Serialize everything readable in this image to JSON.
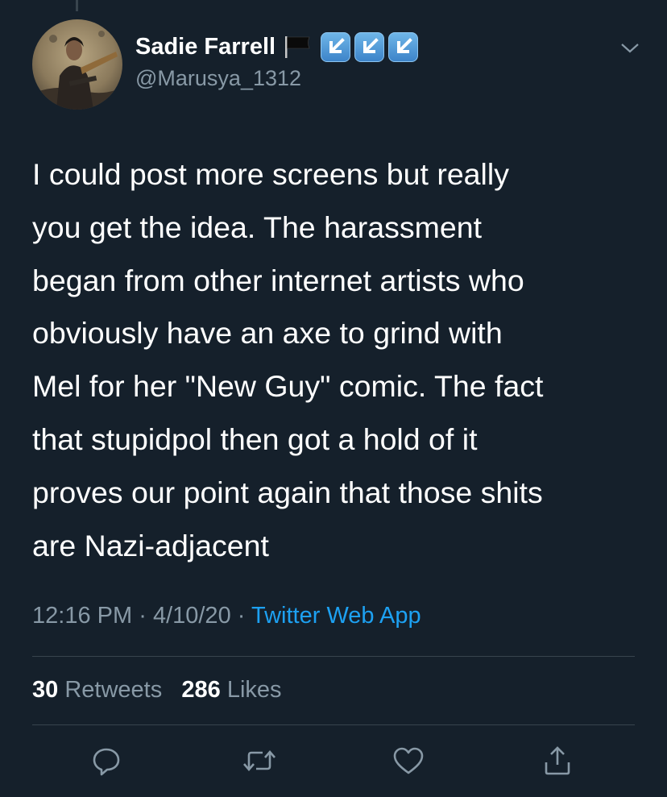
{
  "author": {
    "display_name": "Sadie Farrell",
    "handle": "@Marusya_1312",
    "flag_emoji": "black-flag-icon",
    "badges": [
      "arrow-down-left-icon",
      "arrow-down-left-icon",
      "arrow-down-left-icon"
    ]
  },
  "tweet": {
    "text": "I could post more screens but really\nyou get the idea. The harassment\nbegan from other internet artists who\nobviously have an axe to grind with\nMel for her \"New Guy\" comic. The fact\nthat stupidpol then got a hold of it\nproves our point again that those shits\nare Nazi-adjacent",
    "time": "12:16 PM",
    "date": "4/10/20",
    "separator": "·",
    "source": "Twitter Web App"
  },
  "stats": {
    "retweets_count": "30",
    "retweets_label": "Retweets",
    "likes_count": "286",
    "likes_label": "Likes"
  },
  "actions": [
    "reply-icon",
    "retweet-icon",
    "like-icon",
    "share-icon"
  ],
  "colors": {
    "background": "#15202b",
    "text": "#ffffff",
    "muted": "#8899a6",
    "link": "#1da1f2",
    "divider": "#38444d"
  }
}
